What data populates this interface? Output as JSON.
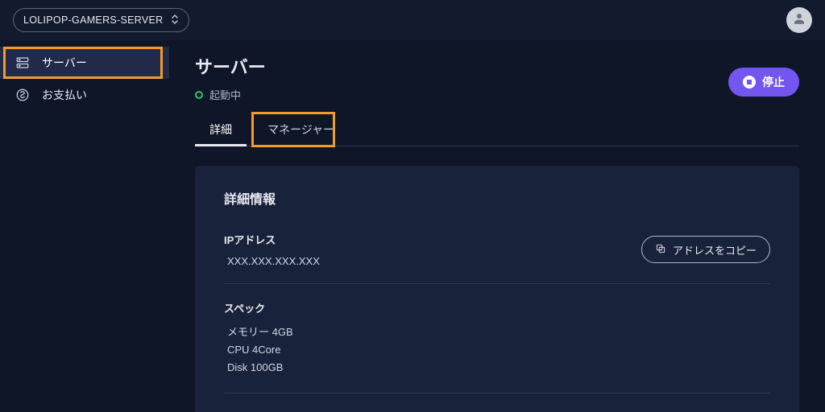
{
  "topbar": {
    "server_selector_label": "LOLIPOP-GAMERS-SERVER"
  },
  "sidebar": {
    "items": [
      {
        "label": "サーバー"
      },
      {
        "label": "お支払い"
      }
    ]
  },
  "page": {
    "title": "サーバー",
    "status_label": "起動中",
    "stop_button_label": "停止",
    "tabs": [
      {
        "label": "詳細"
      },
      {
        "label": "マネージャー"
      }
    ]
  },
  "detail": {
    "card_title": "詳細情報",
    "ip_label": "IPアドレス",
    "ip_value": "XXX.XXX.XXX.XXX",
    "copy_button_label": "アドレスをコピー",
    "spec_label": "スペック",
    "spec_memory": "メモリー 4GB",
    "spec_cpu": "CPU 4Core",
    "spec_disk": "Disk 100GB"
  }
}
